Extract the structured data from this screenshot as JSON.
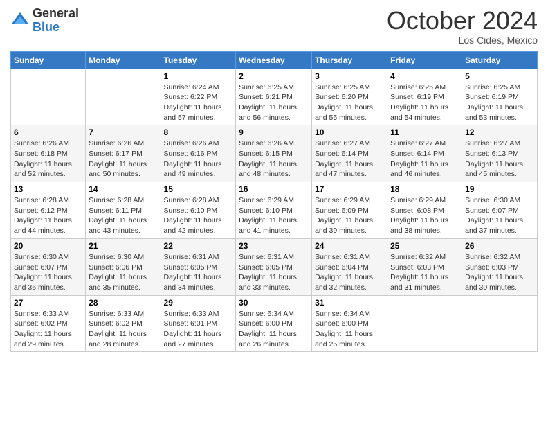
{
  "header": {
    "logo_general": "General",
    "logo_blue": "Blue",
    "month_title": "October 2024",
    "location": "Los Cides, Mexico"
  },
  "days_of_week": [
    "Sunday",
    "Monday",
    "Tuesday",
    "Wednesday",
    "Thursday",
    "Friday",
    "Saturday"
  ],
  "weeks": [
    [
      {
        "day": "",
        "info": ""
      },
      {
        "day": "",
        "info": ""
      },
      {
        "day": "1",
        "info": "Sunrise: 6:24 AM\nSunset: 6:22 PM\nDaylight: 11 hours and 57 minutes."
      },
      {
        "day": "2",
        "info": "Sunrise: 6:25 AM\nSunset: 6:21 PM\nDaylight: 11 hours and 56 minutes."
      },
      {
        "day": "3",
        "info": "Sunrise: 6:25 AM\nSunset: 6:20 PM\nDaylight: 11 hours and 55 minutes."
      },
      {
        "day": "4",
        "info": "Sunrise: 6:25 AM\nSunset: 6:19 PM\nDaylight: 11 hours and 54 minutes."
      },
      {
        "day": "5",
        "info": "Sunrise: 6:25 AM\nSunset: 6:19 PM\nDaylight: 11 hours and 53 minutes."
      }
    ],
    [
      {
        "day": "6",
        "info": "Sunrise: 6:26 AM\nSunset: 6:18 PM\nDaylight: 11 hours and 52 minutes."
      },
      {
        "day": "7",
        "info": "Sunrise: 6:26 AM\nSunset: 6:17 PM\nDaylight: 11 hours and 50 minutes."
      },
      {
        "day": "8",
        "info": "Sunrise: 6:26 AM\nSunset: 6:16 PM\nDaylight: 11 hours and 49 minutes."
      },
      {
        "day": "9",
        "info": "Sunrise: 6:26 AM\nSunset: 6:15 PM\nDaylight: 11 hours and 48 minutes."
      },
      {
        "day": "10",
        "info": "Sunrise: 6:27 AM\nSunset: 6:14 PM\nDaylight: 11 hours and 47 minutes."
      },
      {
        "day": "11",
        "info": "Sunrise: 6:27 AM\nSunset: 6:14 PM\nDaylight: 11 hours and 46 minutes."
      },
      {
        "day": "12",
        "info": "Sunrise: 6:27 AM\nSunset: 6:13 PM\nDaylight: 11 hours and 45 minutes."
      }
    ],
    [
      {
        "day": "13",
        "info": "Sunrise: 6:28 AM\nSunset: 6:12 PM\nDaylight: 11 hours and 44 minutes."
      },
      {
        "day": "14",
        "info": "Sunrise: 6:28 AM\nSunset: 6:11 PM\nDaylight: 11 hours and 43 minutes."
      },
      {
        "day": "15",
        "info": "Sunrise: 6:28 AM\nSunset: 6:10 PM\nDaylight: 11 hours and 42 minutes."
      },
      {
        "day": "16",
        "info": "Sunrise: 6:29 AM\nSunset: 6:10 PM\nDaylight: 11 hours and 41 minutes."
      },
      {
        "day": "17",
        "info": "Sunrise: 6:29 AM\nSunset: 6:09 PM\nDaylight: 11 hours and 39 minutes."
      },
      {
        "day": "18",
        "info": "Sunrise: 6:29 AM\nSunset: 6:08 PM\nDaylight: 11 hours and 38 minutes."
      },
      {
        "day": "19",
        "info": "Sunrise: 6:30 AM\nSunset: 6:07 PM\nDaylight: 11 hours and 37 minutes."
      }
    ],
    [
      {
        "day": "20",
        "info": "Sunrise: 6:30 AM\nSunset: 6:07 PM\nDaylight: 11 hours and 36 minutes."
      },
      {
        "day": "21",
        "info": "Sunrise: 6:30 AM\nSunset: 6:06 PM\nDaylight: 11 hours and 35 minutes."
      },
      {
        "day": "22",
        "info": "Sunrise: 6:31 AM\nSunset: 6:05 PM\nDaylight: 11 hours and 34 minutes."
      },
      {
        "day": "23",
        "info": "Sunrise: 6:31 AM\nSunset: 6:05 PM\nDaylight: 11 hours and 33 minutes."
      },
      {
        "day": "24",
        "info": "Sunrise: 6:31 AM\nSunset: 6:04 PM\nDaylight: 11 hours and 32 minutes."
      },
      {
        "day": "25",
        "info": "Sunrise: 6:32 AM\nSunset: 6:03 PM\nDaylight: 11 hours and 31 minutes."
      },
      {
        "day": "26",
        "info": "Sunrise: 6:32 AM\nSunset: 6:03 PM\nDaylight: 11 hours and 30 minutes."
      }
    ],
    [
      {
        "day": "27",
        "info": "Sunrise: 6:33 AM\nSunset: 6:02 PM\nDaylight: 11 hours and 29 minutes."
      },
      {
        "day": "28",
        "info": "Sunrise: 6:33 AM\nSunset: 6:02 PM\nDaylight: 11 hours and 28 minutes."
      },
      {
        "day": "29",
        "info": "Sunrise: 6:33 AM\nSunset: 6:01 PM\nDaylight: 11 hours and 27 minutes."
      },
      {
        "day": "30",
        "info": "Sunrise: 6:34 AM\nSunset: 6:00 PM\nDaylight: 11 hours and 26 minutes."
      },
      {
        "day": "31",
        "info": "Sunrise: 6:34 AM\nSunset: 6:00 PM\nDaylight: 11 hours and 25 minutes."
      },
      {
        "day": "",
        "info": ""
      },
      {
        "day": "",
        "info": ""
      }
    ]
  ]
}
